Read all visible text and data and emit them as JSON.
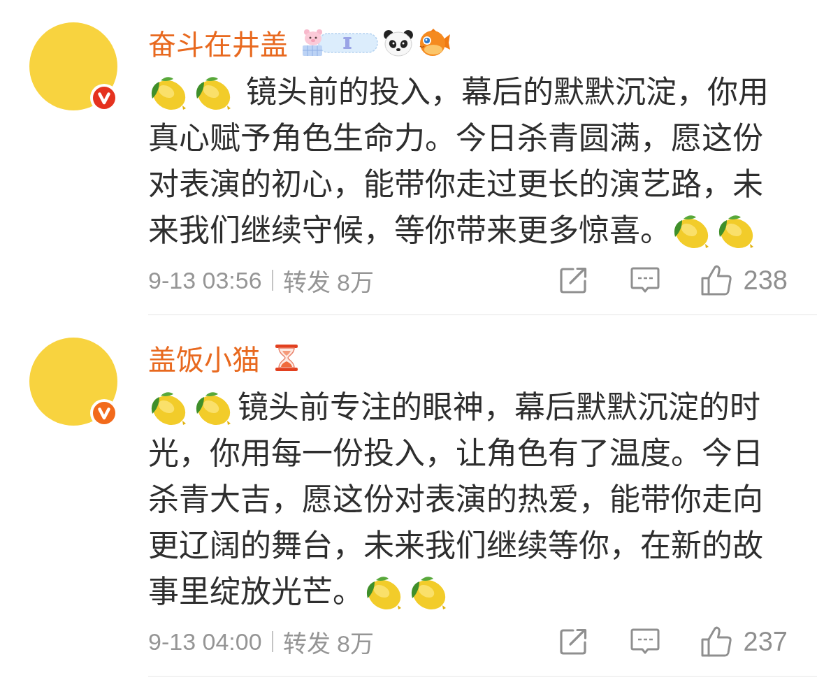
{
  "comments": [
    {
      "verified_badge": {
        "color": "#e5321f"
      },
      "name": "奋斗在井盖",
      "badges": [
        {
          "kind": "sticker"
        },
        {
          "kind": "panda"
        },
        {
          "kind": "pufferfish"
        }
      ],
      "content": [
        {
          "kind": "emoji"
        },
        {
          "kind": "emoji"
        },
        {
          "kind": "text",
          "text": " 镜头前的投入，幕后的默默沉淀，你用"
        },
        {
          "kind": "text",
          "text": "真心赋予角色生命力。今日杀青圆满，愿这份对表演的初心，能带你走过更长的演艺路，未"
        },
        {
          "kind": "text",
          "text": "来我们继续守候，等你带来更多惊喜。"
        },
        {
          "kind": "emoji"
        },
        {
          "kind": "emoji"
        }
      ],
      "time": "9-13 03:56",
      "reposts": "转发 8万",
      "likes": "238"
    },
    {
      "verified_badge": {
        "color": "#f26a1b"
      },
      "name": "盖饭小猫",
      "badges": [
        {
          "kind": "hourglass"
        }
      ],
      "content": [
        {
          "kind": "emoji"
        },
        {
          "kind": "emoji"
        },
        {
          "kind": "text",
          "text": "镜头前专注的眼神，幕后默默沉淀的时"
        },
        {
          "kind": "text",
          "text": "光，你用每一份投入，让角色有了温度。今日杀青大吉，愿这份对表演的热爱，能带你走向更辽阔的舞台，未来我们继续等你，在新的故"
        },
        {
          "kind": "text",
          "text": "事里绽放光芒。"
        },
        {
          "kind": "emoji"
        },
        {
          "kind": "emoji"
        }
      ],
      "time": "9-13 04:00",
      "reposts": "转发 8万",
      "likes": "237"
    }
  ]
}
